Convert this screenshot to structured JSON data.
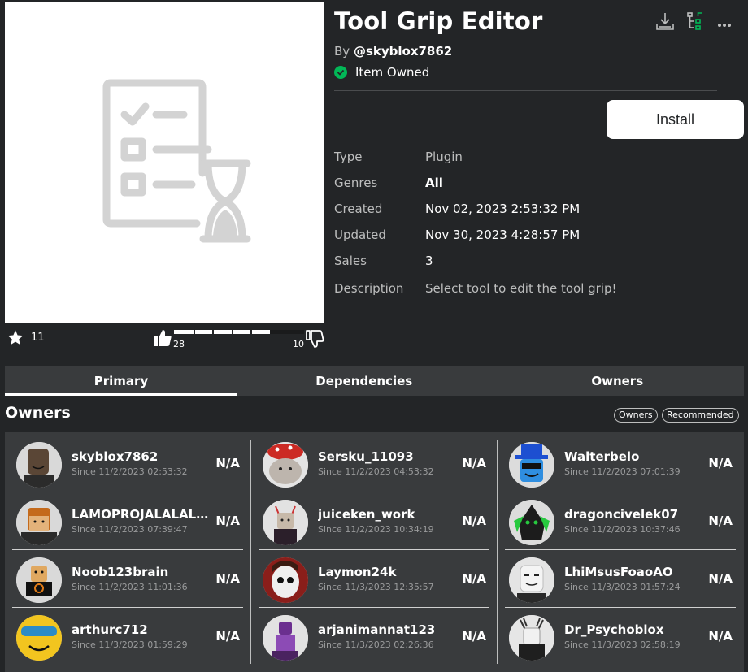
{
  "item": {
    "title": "Tool Grip Editor",
    "by_prefix": "By",
    "creator": "@skyblox7862",
    "owned_label": "Item Owned",
    "install_label": "Install"
  },
  "icons": {
    "download": "download-icon",
    "tree": "hierarchy-icon",
    "more": "more-icon",
    "favorite": "star-icon",
    "upvote": "thumbs-up-icon",
    "downvote": "thumbs-down-icon",
    "owned": "check-circle-icon"
  },
  "rating": {
    "favorites": "11",
    "upvotes": "28",
    "downvotes": "10",
    "upvote_fraction": 0.7368
  },
  "details": [
    {
      "key": "Type",
      "value": "Plugin"
    },
    {
      "key": "Genres",
      "value": "All"
    },
    {
      "key": "Created",
      "value": "Nov 02, 2023 2:53:32 PM"
    },
    {
      "key": "Updated",
      "value": "Nov 30, 2023 4:28:57 PM"
    },
    {
      "key": "Sales",
      "value": "3"
    },
    {
      "key": "Description",
      "value": "Select tool to edit the tool grip!"
    }
  ],
  "tabs": [
    {
      "label": "Primary",
      "active": true
    },
    {
      "label": "Dependencies",
      "active": false
    },
    {
      "label": "Owners",
      "active": false
    }
  ],
  "owners_section": {
    "title": "Owners",
    "filter_owners": "Owners",
    "filter_recommended": "Recommended"
  },
  "owners": [
    {
      "name": "skyblox7862",
      "since": "Since 11/2/2023 02:53:32",
      "price": "N/A"
    },
    {
      "name": "Sersku_11093",
      "since": "Since 11/2/2023 04:53:32",
      "price": "N/A"
    },
    {
      "name": "Walterbelo",
      "since": "Since 11/2/2023 07:01:39",
      "price": "N/A"
    },
    {
      "name": "LAMOPROJALALALALA",
      "since": "Since 11/2/2023 07:39:47",
      "price": "N/A"
    },
    {
      "name": "juiceken_work",
      "since": "Since 11/2/2023 10:34:19",
      "price": "N/A"
    },
    {
      "name": "dragoncivelek07",
      "since": "Since 11/2/2023 10:37:46",
      "price": "N/A"
    },
    {
      "name": "Noob123brain",
      "since": "Since 11/2/2023 11:01:36",
      "price": "N/A"
    },
    {
      "name": "Laymon24k",
      "since": "Since 11/3/2023 12:35:57",
      "price": "N/A"
    },
    {
      "name": "LhiMsusFoaoAO",
      "since": "Since 11/3/2023 01:57:24",
      "price": "N/A"
    },
    {
      "name": "arthurc712",
      "since": "Since 11/3/2023 01:59:29",
      "price": "N/A"
    },
    {
      "name": "arjanimannat123",
      "since": "Since 11/3/2023 02:26:36",
      "price": "N/A"
    },
    {
      "name": "Dr_Psychoblox",
      "since": "Since 11/3/2023 02:58:19",
      "price": "N/A"
    }
  ],
  "colors": {
    "background": "#232527",
    "panel": "#393b3d",
    "owned_green": "#02b757",
    "muted_text": "#bdbebe"
  }
}
